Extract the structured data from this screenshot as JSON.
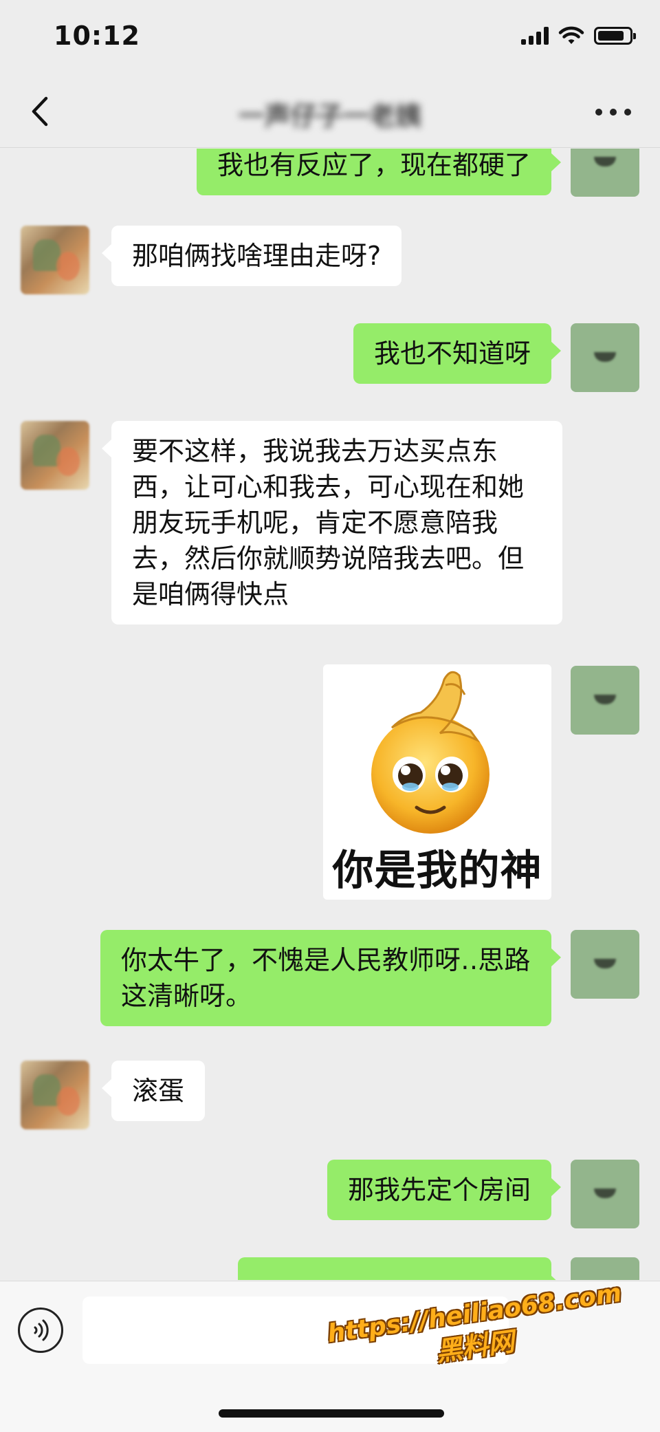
{
  "status_bar": {
    "time": "10:12",
    "battery_level": 0.85
  },
  "nav": {
    "title": "一声仔子一老姨"
  },
  "messages": [
    {
      "from": "self",
      "text": "我也有反应了，现在都硬了"
    },
    {
      "from": "other",
      "text": "那咱俩找啥理由走呀?"
    },
    {
      "from": "self",
      "text": "我也不知道呀"
    },
    {
      "from": "other",
      "text": "要不这样，我说我去万达买点东西，让可心和我去，可心现在和她朋友玩手机呢，肯定不愿意陪我去，然后你就顺势说陪我去吧。但是咱俩得快点"
    },
    {
      "from": "self",
      "type": "sticker",
      "caption": "你是我的神"
    },
    {
      "from": "self",
      "text": "你太牛了，不愧是人民教师呀‥思路这清晰呀。"
    },
    {
      "from": "other",
      "text": "滚蛋"
    },
    {
      "from": "self",
      "text": "那我先定个房间"
    }
  ],
  "watermark": {
    "url": "https://heiliao68.com",
    "name": "黑料网"
  },
  "colors": {
    "background": "#ededed",
    "outgoing_bubble": "#95ec69",
    "incoming_bubble": "#ffffff",
    "watermark": "#ffae1a"
  },
  "icons": [
    "back-chevron-icon",
    "more-dots-icon",
    "signal-icon",
    "wifi-icon",
    "battery-icon",
    "voice-icon"
  ]
}
